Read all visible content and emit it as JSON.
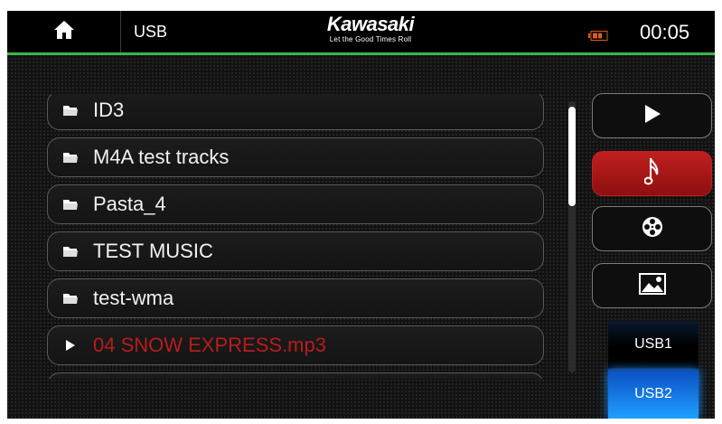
{
  "header": {
    "home_icon": "home-icon",
    "source": "USB",
    "brand_name": "Kawasaki",
    "brand_tagline": "Let the Good Times Roll",
    "battery_icon": "battery-icon",
    "time": "00:05",
    "accent_color": "#3cb64a"
  },
  "list": {
    "items": [
      {
        "label": "ID3",
        "icon": "folder-icon"
      },
      {
        "label": "M4A test tracks",
        "icon": "folder-icon"
      },
      {
        "label": "Pasta_4",
        "icon": "folder-icon"
      },
      {
        "label": "TEST MUSIC",
        "icon": "folder-icon"
      },
      {
        "label": "test-wma",
        "icon": "folder-icon"
      },
      {
        "label": "04 SNOW EXPRESS.mp3",
        "icon": "play-icon",
        "playing": true
      }
    ],
    "playing_color": "#b81c1c"
  },
  "modes": {
    "buttons": [
      {
        "name": "play",
        "icon": "play-icon"
      },
      {
        "name": "music",
        "icon": "music-note-icon",
        "active": true
      },
      {
        "name": "video",
        "icon": "film-reel-icon"
      },
      {
        "name": "photo",
        "icon": "image-icon"
      }
    ],
    "active_color": "#c0201f"
  },
  "sources": {
    "usb1": "USB1",
    "usb2": "USB2",
    "selected": "USB2",
    "selected_color": "#1e90ff"
  }
}
